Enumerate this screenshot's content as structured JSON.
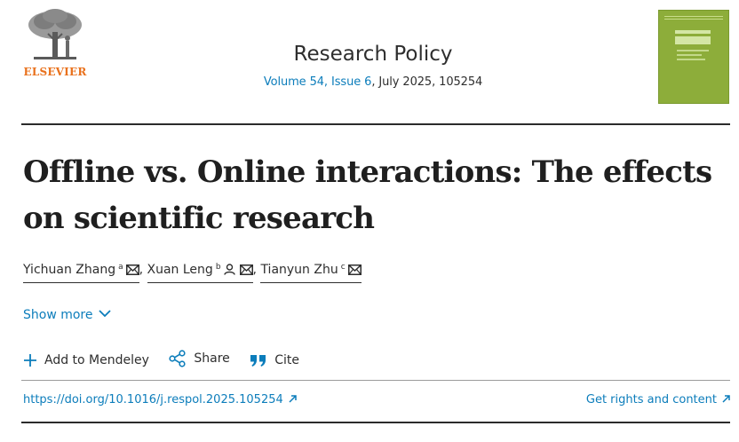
{
  "header": {
    "publisher_logo_text": "ELSEVIER",
    "journal_title": "Research Policy",
    "volume_link": "Volume 54, Issue 6",
    "issue_rest": ", July 2025, 105254"
  },
  "article": {
    "title_line1": "Offline vs. Online interactions: The effects",
    "title_line2": "on scientific research"
  },
  "authors": [
    {
      "name": "Yichuan Zhang",
      "sup": "a"
    },
    {
      "name": "Xuan Leng",
      "sup": "b"
    },
    {
      "name": "Tianyun Zhu",
      "sup": "c"
    }
  ],
  "separator": ",",
  "show_more": {
    "label": "Show more"
  },
  "actions": {
    "mendeley": "Add to Mendeley",
    "share": "Share",
    "cite": "Cite"
  },
  "links": {
    "doi": "https://doi.org/10.1016/j.respol.2025.105254",
    "rights": "Get rights and content"
  },
  "colors": {
    "link": "#0c7dbb",
    "elsevier_orange": "#e9711c",
    "cover_green": "#8dad3a"
  },
  "icons": {
    "email": "envelope-icon",
    "person": "person-icon",
    "external": "external-link-arrow-icon",
    "plus": "plus-icon",
    "share": "share-icon",
    "cite": "quote-icon",
    "chevron": "chevron-down-icon"
  }
}
